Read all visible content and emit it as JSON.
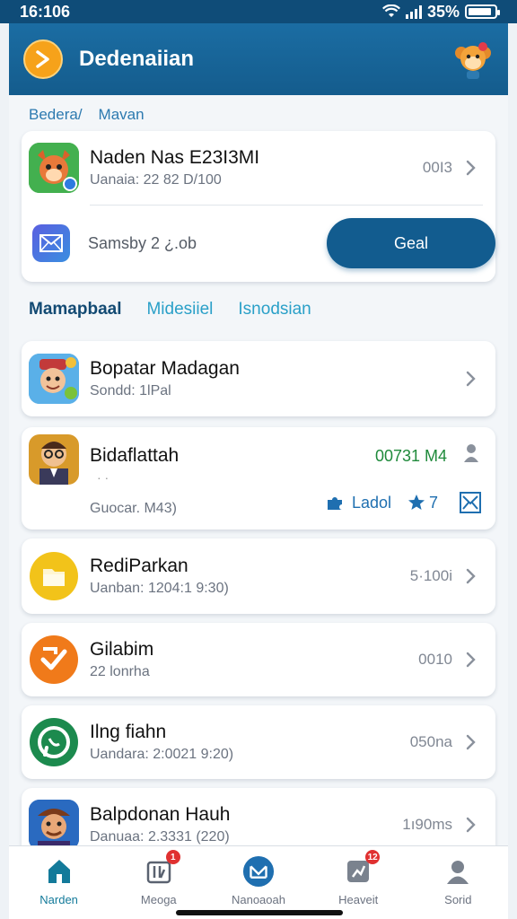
{
  "status": {
    "time": "16:106",
    "battery_text": "35%",
    "battery_level": 0.9
  },
  "header": {
    "nav_icon": "chevron-right-icon",
    "title": "Dedenaiian",
    "mascot": "mascot-avatar"
  },
  "breadcrumb": {
    "first": "Bedera/",
    "second": "Mavan"
  },
  "top_card": {
    "item_title": "Naden Nas E23I3MI",
    "item_sub": "Uanaia: 22 82 D/100",
    "item_meta": "00I3",
    "row2_text": "Samsby 2 ¿.ob",
    "button_label": "Geal"
  },
  "tabs": [
    "Mamapbaal",
    "Midesiiel",
    "Isnodsian"
  ],
  "items": [
    {
      "title": "Bopatar Madagan",
      "sub": "Sondd: 1lPal",
      "meta": ""
    },
    {
      "title": "Bidaflattah",
      "sub": "Guocar. M43)",
      "meta": "00731 M4",
      "tag": "Ladol",
      "rating": "7"
    },
    {
      "title": "RediParkan",
      "sub": "Uanban: 1204:1 9:30)",
      "meta": "5·100i"
    },
    {
      "title": "Gilabim",
      "sub": "22 lonrha",
      "meta": "0010"
    },
    {
      "title": "Ilng fiahn",
      "sub": "Uandara: 2:0021 9:20)",
      "meta": "050na"
    },
    {
      "title": "Balpdonan Hauh",
      "sub": "Danuaa: 2.3331 (220)",
      "meta": "1ı90ms"
    }
  ],
  "nav": [
    {
      "label": "Narden",
      "icon": "home-icon",
      "badge": ""
    },
    {
      "label": "Meoga",
      "icon": "library-icon",
      "badge": "1"
    },
    {
      "label": "Nanoaoah",
      "icon": "mail-icon",
      "badge": ""
    },
    {
      "label": "Heaveit",
      "icon": "activity-icon",
      "badge": "12"
    },
    {
      "label": "Sorid",
      "icon": "profile-icon",
      "badge": ""
    }
  ],
  "colors": {
    "primary": "#125c8f",
    "accent": "#f6a21a",
    "tab_active": "#124a73",
    "tab": "#2aa0c8",
    "green_meta": "#1f8a3b"
  }
}
